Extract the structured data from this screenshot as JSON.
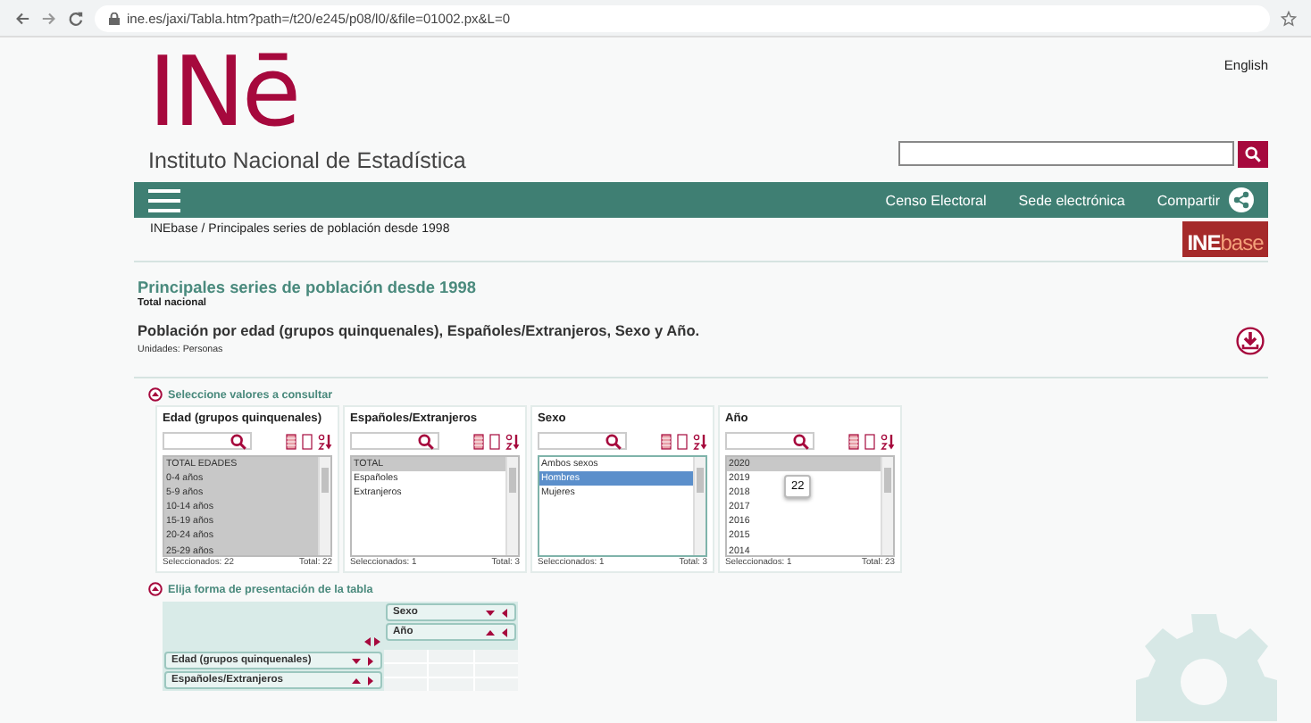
{
  "browser": {
    "url": "ine.es/jaxi/Tabla.htm?path=/t20/e245/p08/l0/&file=01002.px&L=0"
  },
  "header": {
    "language_link": "English",
    "logo": "INē",
    "institute": "Instituto Nacional de Estadística",
    "nav": [
      "Censo Electoral",
      "Sede electrónica",
      "Compartir"
    ],
    "breadcrumb": "INEbase / Principales series de población desde 1998",
    "badge": {
      "left": "INE",
      "right": "base"
    }
  },
  "title": "Principales series de población desde 1998",
  "subtitle": "Total nacional",
  "table_title": "Población por edad (grupos quinquenales), Españoles/Extranjeros, Sexo y Año.",
  "units": "Unidades: Personas",
  "select_section": {
    "label": "Seleccione valores a consultar",
    "expanded": true,
    "variables": [
      {
        "name": "Edad (grupos quinquenales)",
        "focused": false,
        "items": [
          {
            "label": "TOTAL EDADES",
            "selected": true
          },
          {
            "label": "0-4 años",
            "selected": true
          },
          {
            "label": "5-9 años",
            "selected": true
          },
          {
            "label": "10-14 años",
            "selected": true
          },
          {
            "label": "15-19 años",
            "selected": true
          },
          {
            "label": "20-24 años",
            "selected": true
          },
          {
            "label": "25-29 años",
            "selected": true
          }
        ],
        "selected_count": "Seleccionados: 22",
        "total": "Total: 22"
      },
      {
        "name": "Españoles/Extranjeros",
        "focused": false,
        "items": [
          {
            "label": "TOTAL",
            "selected": true
          },
          {
            "label": "Españoles",
            "selected": false
          },
          {
            "label": "Extranjeros",
            "selected": false
          }
        ],
        "selected_count": "Seleccionados: 1",
        "total": "Total: 3"
      },
      {
        "name": "Sexo",
        "focused": true,
        "items": [
          {
            "label": "Ambos sexos",
            "selected": false
          },
          {
            "label": "Hombres",
            "selected": true
          },
          {
            "label": "Mujeres",
            "selected": false
          }
        ],
        "selected_count": "Seleccionados: 1",
        "total": "Total: 3"
      },
      {
        "name": "Año",
        "focused": false,
        "tooltip": "22",
        "items": [
          {
            "label": "2020",
            "selected": true
          },
          {
            "label": "2019",
            "selected": false
          },
          {
            "label": "2018",
            "selected": false
          },
          {
            "label": "2017",
            "selected": false
          },
          {
            "label": "2016",
            "selected": false
          },
          {
            "label": "2015",
            "selected": false
          },
          {
            "label": "2014",
            "selected": false
          }
        ],
        "selected_count": "Seleccionados: 1",
        "total": "Total: 23"
      }
    ]
  },
  "layout_section": {
    "label": "Elija forma de presentación de la tabla",
    "expanded": true,
    "columns": [
      "Sexo",
      "Año"
    ],
    "rows": [
      "Edad (grupos quinquenales)",
      "Españoles/Extranjeros"
    ]
  }
}
